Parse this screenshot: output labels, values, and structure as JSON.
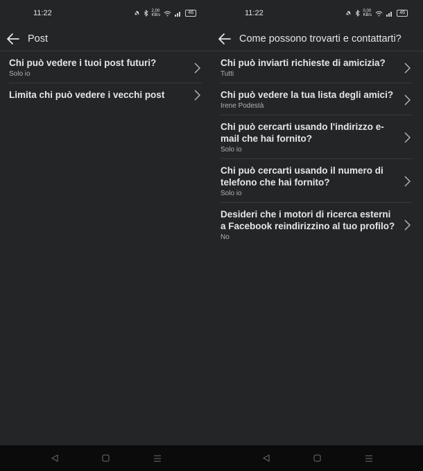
{
  "left": {
    "status": {
      "time": "11:22",
      "speed": "2,00\nKB/s",
      "battery": "46"
    },
    "header": {
      "title": "Post"
    },
    "items": [
      {
        "title": "Chi può vedere i tuoi post futuri?",
        "sub": "Solo io"
      },
      {
        "title": "Limita chi può vedere i vecchi post",
        "sub": ""
      }
    ]
  },
  "right": {
    "status": {
      "time": "11:22",
      "speed": "0,00\nKB/s",
      "battery": "46"
    },
    "header": {
      "title": "Come possono trovarti e contattarti?"
    },
    "items": [
      {
        "title": "Chi può inviarti richieste di amicizia?",
        "sub": "Tutti"
      },
      {
        "title": "Chi può vedere la tua lista degli amici?",
        "sub": "Irene Podestà"
      },
      {
        "title": "Chi può cercarti usando l'indirizzo e-mail che hai fornito?",
        "sub": "Solo io"
      },
      {
        "title": "Chi può cercarti usando il numero di telefono che hai fornito?",
        "sub": "Solo io"
      },
      {
        "title": "Desideri che i motori di ricerca esterni a Facebook reindirizzino al tuo profilo?",
        "sub": "No"
      }
    ]
  },
  "icons": {
    "back": "arrow-left",
    "chevron": "chevron-right",
    "nav_back": "triangle",
    "nav_home": "square",
    "nav_menu": "three-lines"
  }
}
